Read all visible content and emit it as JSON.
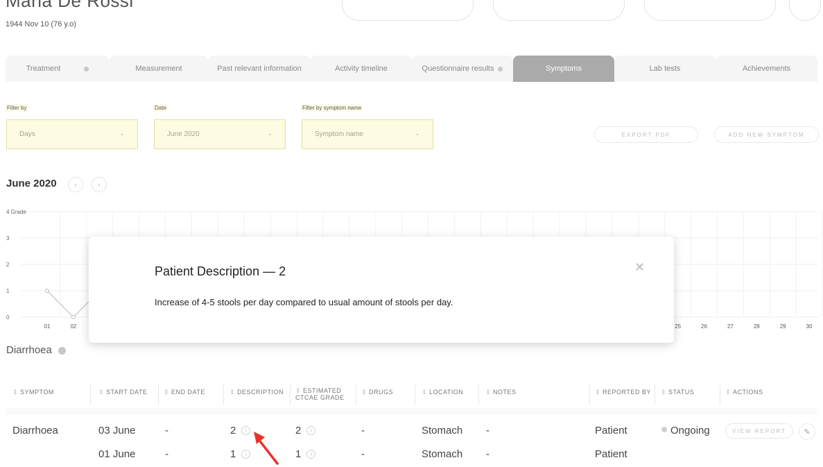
{
  "patient": {
    "name": "Maria De Rossi",
    "dob": "1944 Nov 10 (76 y.o)"
  },
  "tabs": [
    {
      "label": "Treatment",
      "dot": true
    },
    {
      "label": "Measurement",
      "dot": false
    },
    {
      "label": "Past relevant information",
      "dot": false
    },
    {
      "label": "Activity timeline",
      "dot": false
    },
    {
      "label": "Questionnaire results",
      "dot": true
    },
    {
      "label": "Symptoms",
      "dot": false,
      "active": true
    },
    {
      "label": "Lab tests",
      "dot": false
    },
    {
      "label": "Achievements",
      "dot": false
    }
  ],
  "filters": {
    "filter_by": {
      "label": "Filter by",
      "value": "Days"
    },
    "date": {
      "label": "Date",
      "value": "June 2020"
    },
    "symptom": {
      "label": "Filter by symptom name",
      "placeholder": "Symptom name"
    }
  },
  "actions": {
    "export_pdf": "EXPORT PDF",
    "add_symptom": "ADD NEW SYMPTOM"
  },
  "chart_nav": {
    "month": "June 2020",
    "prev": "‹",
    "next": "›"
  },
  "chart_data": {
    "type": "line",
    "y_ticks": [
      "4 Grade",
      "3",
      "2",
      "1",
      "0"
    ],
    "x_ticks_visible_left": [
      "01",
      "02"
    ],
    "x_ticks_visible_right": [
      "25",
      "26",
      "27",
      "28",
      "29",
      "30"
    ],
    "series": [
      {
        "x": [
          "01",
          "02",
          "03"
        ],
        "values": [
          1,
          0,
          1
        ]
      }
    ],
    "ylim": [
      0,
      4
    ],
    "grid": true,
    "line_color": "#cccccc"
  },
  "symptom": {
    "name": "Diarrhoea",
    "status_color": "#c8c8c8"
  },
  "table": {
    "headers": [
      "SYMPTOM",
      "START DATE",
      "END DATE",
      "DESCRIPTION",
      "ESTIMATED CTCAE GRADE",
      "DRUGS",
      "LOCATION",
      "NOTES",
      "REPORTED BY",
      "STATUS",
      "ACTIONS"
    ],
    "rows": [
      {
        "symptom": "Diarrhoea",
        "start": "03 June",
        "end": "-",
        "description": "2",
        "grade": "2",
        "drugs": "-",
        "location": "Stomach",
        "notes": "-",
        "reported_by": "Patient",
        "status": "Ongoing"
      },
      {
        "symptom": "",
        "start": "01 June",
        "end": "-",
        "description": "1",
        "grade": "1",
        "drugs": "-",
        "location": "Stomach",
        "notes": "-",
        "reported_by": "Patient",
        "status": ""
      }
    ],
    "view_report": "VIEW REPORT",
    "info_glyph": "i",
    "edit_glyph": "✎"
  },
  "modal": {
    "title": "Patient Description — 2",
    "body": "Increase of 4-5 stools per day compared to usual amount of stools per day.",
    "close": "✕"
  },
  "colors": {
    "accent_active_tab": "#aaaaaa",
    "filter_bg": "#fdfbe2",
    "arrow": "#e8322b"
  }
}
